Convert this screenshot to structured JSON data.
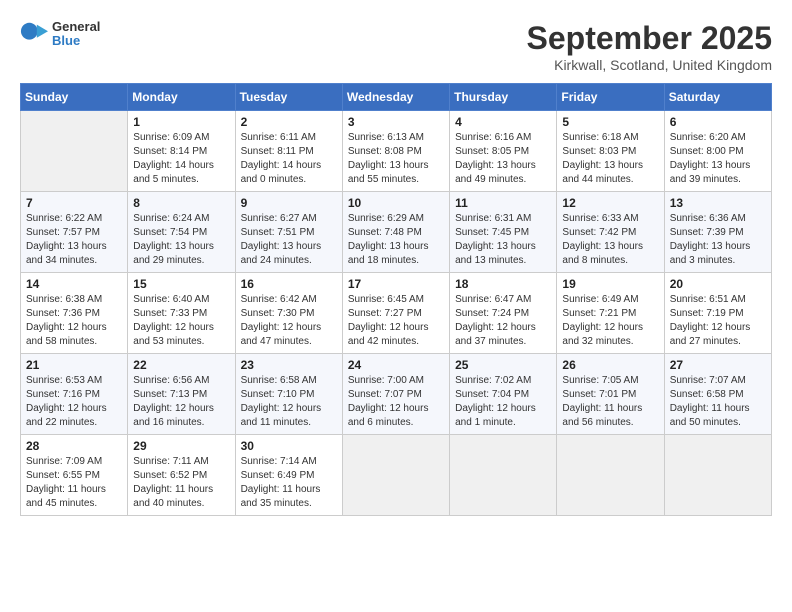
{
  "header": {
    "logo_general": "General",
    "logo_blue": "Blue",
    "month_title": "September 2025",
    "location": "Kirkwall, Scotland, United Kingdom"
  },
  "days_of_week": [
    "Sunday",
    "Monday",
    "Tuesday",
    "Wednesday",
    "Thursday",
    "Friday",
    "Saturday"
  ],
  "weeks": [
    [
      {
        "day": "",
        "empty": true
      },
      {
        "day": "1",
        "sunrise": "Sunrise: 6:09 AM",
        "sunset": "Sunset: 8:14 PM",
        "daylight": "Daylight: 14 hours and 5 minutes."
      },
      {
        "day": "2",
        "sunrise": "Sunrise: 6:11 AM",
        "sunset": "Sunset: 8:11 PM",
        "daylight": "Daylight: 14 hours and 0 minutes."
      },
      {
        "day": "3",
        "sunrise": "Sunrise: 6:13 AM",
        "sunset": "Sunset: 8:08 PM",
        "daylight": "Daylight: 13 hours and 55 minutes."
      },
      {
        "day": "4",
        "sunrise": "Sunrise: 6:16 AM",
        "sunset": "Sunset: 8:05 PM",
        "daylight": "Daylight: 13 hours and 49 minutes."
      },
      {
        "day": "5",
        "sunrise": "Sunrise: 6:18 AM",
        "sunset": "Sunset: 8:03 PM",
        "daylight": "Daylight: 13 hours and 44 minutes."
      },
      {
        "day": "6",
        "sunrise": "Sunrise: 6:20 AM",
        "sunset": "Sunset: 8:00 PM",
        "daylight": "Daylight: 13 hours and 39 minutes."
      }
    ],
    [
      {
        "day": "7",
        "sunrise": "Sunrise: 6:22 AM",
        "sunset": "Sunset: 7:57 PM",
        "daylight": "Daylight: 13 hours and 34 minutes."
      },
      {
        "day": "8",
        "sunrise": "Sunrise: 6:24 AM",
        "sunset": "Sunset: 7:54 PM",
        "daylight": "Daylight: 13 hours and 29 minutes."
      },
      {
        "day": "9",
        "sunrise": "Sunrise: 6:27 AM",
        "sunset": "Sunset: 7:51 PM",
        "daylight": "Daylight: 13 hours and 24 minutes."
      },
      {
        "day": "10",
        "sunrise": "Sunrise: 6:29 AM",
        "sunset": "Sunset: 7:48 PM",
        "daylight": "Daylight: 13 hours and 18 minutes."
      },
      {
        "day": "11",
        "sunrise": "Sunrise: 6:31 AM",
        "sunset": "Sunset: 7:45 PM",
        "daylight": "Daylight: 13 hours and 13 minutes."
      },
      {
        "day": "12",
        "sunrise": "Sunrise: 6:33 AM",
        "sunset": "Sunset: 7:42 PM",
        "daylight": "Daylight: 13 hours and 8 minutes."
      },
      {
        "day": "13",
        "sunrise": "Sunrise: 6:36 AM",
        "sunset": "Sunset: 7:39 PM",
        "daylight": "Daylight: 13 hours and 3 minutes."
      }
    ],
    [
      {
        "day": "14",
        "sunrise": "Sunrise: 6:38 AM",
        "sunset": "Sunset: 7:36 PM",
        "daylight": "Daylight: 12 hours and 58 minutes."
      },
      {
        "day": "15",
        "sunrise": "Sunrise: 6:40 AM",
        "sunset": "Sunset: 7:33 PM",
        "daylight": "Daylight: 12 hours and 53 minutes."
      },
      {
        "day": "16",
        "sunrise": "Sunrise: 6:42 AM",
        "sunset": "Sunset: 7:30 PM",
        "daylight": "Daylight: 12 hours and 47 minutes."
      },
      {
        "day": "17",
        "sunrise": "Sunrise: 6:45 AM",
        "sunset": "Sunset: 7:27 PM",
        "daylight": "Daylight: 12 hours and 42 minutes."
      },
      {
        "day": "18",
        "sunrise": "Sunrise: 6:47 AM",
        "sunset": "Sunset: 7:24 PM",
        "daylight": "Daylight: 12 hours and 37 minutes."
      },
      {
        "day": "19",
        "sunrise": "Sunrise: 6:49 AM",
        "sunset": "Sunset: 7:21 PM",
        "daylight": "Daylight: 12 hours and 32 minutes."
      },
      {
        "day": "20",
        "sunrise": "Sunrise: 6:51 AM",
        "sunset": "Sunset: 7:19 PM",
        "daylight": "Daylight: 12 hours and 27 minutes."
      }
    ],
    [
      {
        "day": "21",
        "sunrise": "Sunrise: 6:53 AM",
        "sunset": "Sunset: 7:16 PM",
        "daylight": "Daylight: 12 hours and 22 minutes."
      },
      {
        "day": "22",
        "sunrise": "Sunrise: 6:56 AM",
        "sunset": "Sunset: 7:13 PM",
        "daylight": "Daylight: 12 hours and 16 minutes."
      },
      {
        "day": "23",
        "sunrise": "Sunrise: 6:58 AM",
        "sunset": "Sunset: 7:10 PM",
        "daylight": "Daylight: 12 hours and 11 minutes."
      },
      {
        "day": "24",
        "sunrise": "Sunrise: 7:00 AM",
        "sunset": "Sunset: 7:07 PM",
        "daylight": "Daylight: 12 hours and 6 minutes."
      },
      {
        "day": "25",
        "sunrise": "Sunrise: 7:02 AM",
        "sunset": "Sunset: 7:04 PM",
        "daylight": "Daylight: 12 hours and 1 minute."
      },
      {
        "day": "26",
        "sunrise": "Sunrise: 7:05 AM",
        "sunset": "Sunset: 7:01 PM",
        "daylight": "Daylight: 11 hours and 56 minutes."
      },
      {
        "day": "27",
        "sunrise": "Sunrise: 7:07 AM",
        "sunset": "Sunset: 6:58 PM",
        "daylight": "Daylight: 11 hours and 50 minutes."
      }
    ],
    [
      {
        "day": "28",
        "sunrise": "Sunrise: 7:09 AM",
        "sunset": "Sunset: 6:55 PM",
        "daylight": "Daylight: 11 hours and 45 minutes."
      },
      {
        "day": "29",
        "sunrise": "Sunrise: 7:11 AM",
        "sunset": "Sunset: 6:52 PM",
        "daylight": "Daylight: 11 hours and 40 minutes."
      },
      {
        "day": "30",
        "sunrise": "Sunrise: 7:14 AM",
        "sunset": "Sunset: 6:49 PM",
        "daylight": "Daylight: 11 hours and 35 minutes."
      },
      {
        "day": "",
        "empty": true
      },
      {
        "day": "",
        "empty": true
      },
      {
        "day": "",
        "empty": true
      },
      {
        "day": "",
        "empty": true
      }
    ]
  ]
}
